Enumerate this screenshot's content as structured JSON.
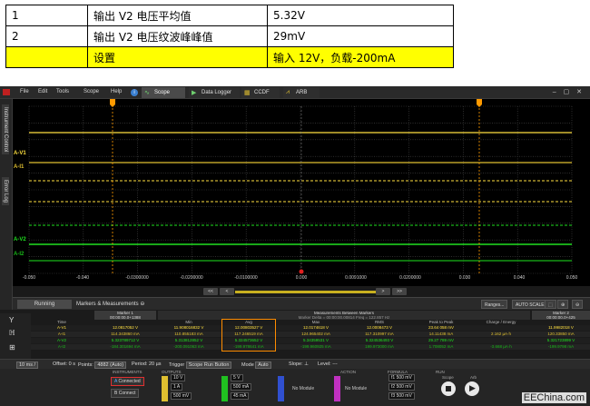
{
  "summary_table": {
    "rows": [
      {
        "id": "1",
        "item": "输出 V2 电压平均值",
        "value": "5.32V"
      },
      {
        "id": "2",
        "item": "输出 V2 电压纹波峰峰值",
        "value": "29mV"
      },
      {
        "id": "",
        "item": "设置",
        "value": "输入 12V，负载-200mA"
      }
    ]
  },
  "menu": [
    "File",
    "Edit",
    "Tools",
    "Scope",
    "Help"
  ],
  "tabs": [
    {
      "label": "Scope",
      "active": true
    },
    {
      "label": "Data Logger",
      "active": false
    },
    {
      "label": "CCDF",
      "active": false
    },
    {
      "label": "ARB",
      "active": false
    }
  ],
  "side_tabs": [
    "Instrument Control",
    "Error Log"
  ],
  "x_ticks": [
    "-0.050",
    "-0.040",
    "-0.0300000",
    "-0.0200000",
    "-0.0100000",
    "0.000",
    "0.0091000",
    "0.0200000",
    "0.030",
    "0.040",
    "0.050"
  ],
  "channel_labels": [
    "A-V1",
    "A-I1",
    "A-V2",
    "A-I2"
  ],
  "colors": {
    "v1": "#ffe040",
    "i1": "#e0c030",
    "v2": "#20e020",
    "i2": "#18b818",
    "marker": "#ff9a00",
    "trigger": "#e02020"
  },
  "meas_bar": {
    "running": "Running",
    "title": "Markers & Measurements",
    "ranges_btn": "Ranges...",
    "autoscale_btn": "AUTO SCALE"
  },
  "meas": {
    "marker1": "Marker 1",
    "marker1_time": "00:00:00.0+1388",
    "between": "Measurements Between Markers",
    "between_sub": "Marker Delta = 00:00:00.00814   Freq = 122.857 Hz",
    "marker2": "Marker 2",
    "marker2_time": "00:00:00.0+425",
    "headers": [
      "Time",
      "",
      "Min",
      "Avg",
      "Max",
      "RMS",
      "Peak to Peak",
      "Charge / Energy",
      ""
    ],
    "rows": [
      {
        "ch": "A-V1",
        "m1": "12.0817052 V",
        "min": "11.908016832 V",
        "avg": "12.00803527 V",
        "max": "12.0174618 V",
        "rms": "12.0008473 V",
        "pp": "23.64 058 mV",
        "ce": "",
        "m2": "11.9982018 V"
      },
      {
        "ch": "A-I1",
        "m1": "114.343860 mA",
        "min": "110.855183 mA",
        "avg": "117.246519 mA",
        "max": "124.965402 mA",
        "rms": "117.310997 mA",
        "pp": "14.11438 mA",
        "ce": "2.162 µA·h",
        "m2": "120.33850 mA"
      },
      {
        "ch": "A-V2",
        "m1": "5.323789712 V",
        "min": "5.313812852 V",
        "avg": "5.324573652 V",
        "max": "5.34359531 V",
        "rms": "5.324536493 V",
        "pp": "29.27 789 mV",
        "ce": "",
        "m2": "5.321723899 V"
      },
      {
        "ch": "A-I2",
        "m1": "-184.301694 mA",
        "min": "-200.091063 mA",
        "avg": "-199.978641 mA",
        "max": "-199.960925 mA",
        "rms": "199.973000 mA",
        "pp": "1.708052 mA",
        "ce": "-3.668 µA·h",
        "m2": "-199.9798 mA"
      }
    ]
  },
  "status": {
    "timebase": "10 ms /",
    "offset": "Offset: 0 s",
    "points_label": "Points:",
    "points": "4882 (Auto)",
    "period": "Period: 20 µs",
    "trigger_label": "Trigger",
    "trigger_value": "Scope Run Button",
    "mode_label": "Mode",
    "mode_value": "Auto",
    "slope_label": "Slope:",
    "level_label": "Level: ---"
  },
  "bottom": {
    "instruments": "INSTRUMENTS",
    "outputs": "OUTPUTS",
    "action": "ACTION",
    "formula": "FORMULA",
    "run": "RUN",
    "connected": "Connected",
    "connect": "Connect",
    "no_module": "No Module",
    "ch1_v": "10 V",
    "ch1_i": "1 A",
    "ch1_m": "500 mV",
    "ch2_v": "5 V",
    "ch2_i": "500 mA",
    "ch2_m": "45 mA",
    "f1": "500 mV",
    "f2": "500 mV",
    "f3": "500 mV",
    "scope": "Scope",
    "arb": "Arb",
    "logo": "EEChina.com"
  }
}
